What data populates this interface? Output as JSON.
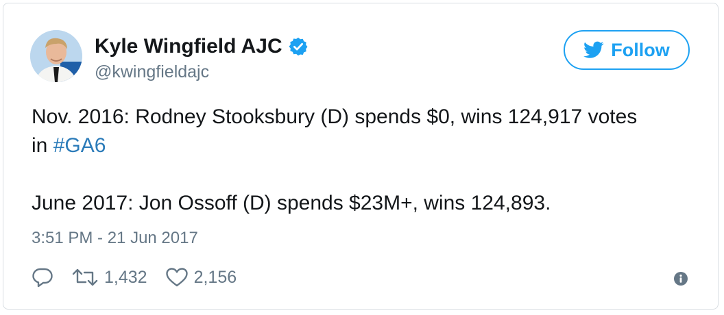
{
  "user": {
    "display_name": "Kyle Wingfield AJC",
    "handle": "@kwingfieldajc",
    "verified_icon": "verified-badge-icon"
  },
  "follow_button": {
    "label": "Follow",
    "icon": "twitter-bird-icon"
  },
  "tweet": {
    "line1_text": "Nov. 2016: Rodney Stooksbury (D) spends $0, wins 124,917 votes",
    "line2_prefix": "in ",
    "hashtag": "#GA6",
    "line3_text": "June 2017: Jon Ossoff (D) spends $23M+, wins 124,893."
  },
  "timestamp": "3:51 PM - 21 Jun 2017",
  "actions": {
    "reply_icon": "reply-icon",
    "retweet_icon": "retweet-icon",
    "retweet_count": "1,432",
    "like_icon": "heart-icon",
    "like_count": "2,156",
    "info_icon": "info-icon"
  },
  "colors": {
    "accent": "#1da1f2",
    "hashtag": "#2b7bb9",
    "secondary_text": "#657786",
    "border": "#d8dde2"
  }
}
